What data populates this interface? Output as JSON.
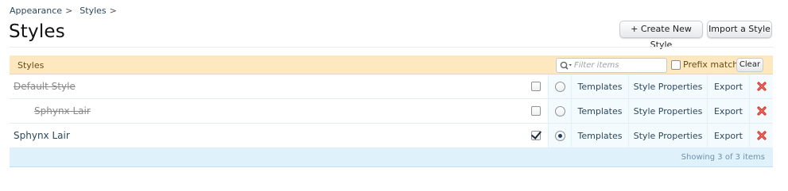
{
  "breadcrumb": {
    "items": [
      "Appearance",
      "Styles"
    ],
    "separator": ">"
  },
  "page_title": "Styles",
  "buttons": {
    "create": "+ Create New Style",
    "import": "Import a Style"
  },
  "list": {
    "header_title": "Styles",
    "filter_placeholder": "Filter items",
    "prefix_match_label": "Prefix match",
    "clear_label": "Clear",
    "rows": [
      {
        "name": "Default Style",
        "disabled": true,
        "indent": 0,
        "checked": false,
        "selected": false,
        "templates": "Templates",
        "properties": "Style Properties",
        "export": "Export"
      },
      {
        "name": "Sphynx Lair",
        "disabled": true,
        "indent": 1,
        "checked": false,
        "selected": false,
        "templates": "Templates",
        "properties": "Style Properties",
        "export": "Export"
      },
      {
        "name": "Sphynx Lair",
        "disabled": false,
        "indent": 0,
        "checked": true,
        "selected": true,
        "templates": "Templates",
        "properties": "Style Properties",
        "export": "Export"
      }
    ],
    "footer_text": "Showing 3 of 3 items"
  },
  "colors": {
    "header_bg": "#fde8c0",
    "footer_bg": "#dff1fb",
    "link": "#2b485c",
    "delete_red": "#d9312b"
  },
  "icons": {
    "search": "search-icon",
    "delete": "delete-icon"
  }
}
